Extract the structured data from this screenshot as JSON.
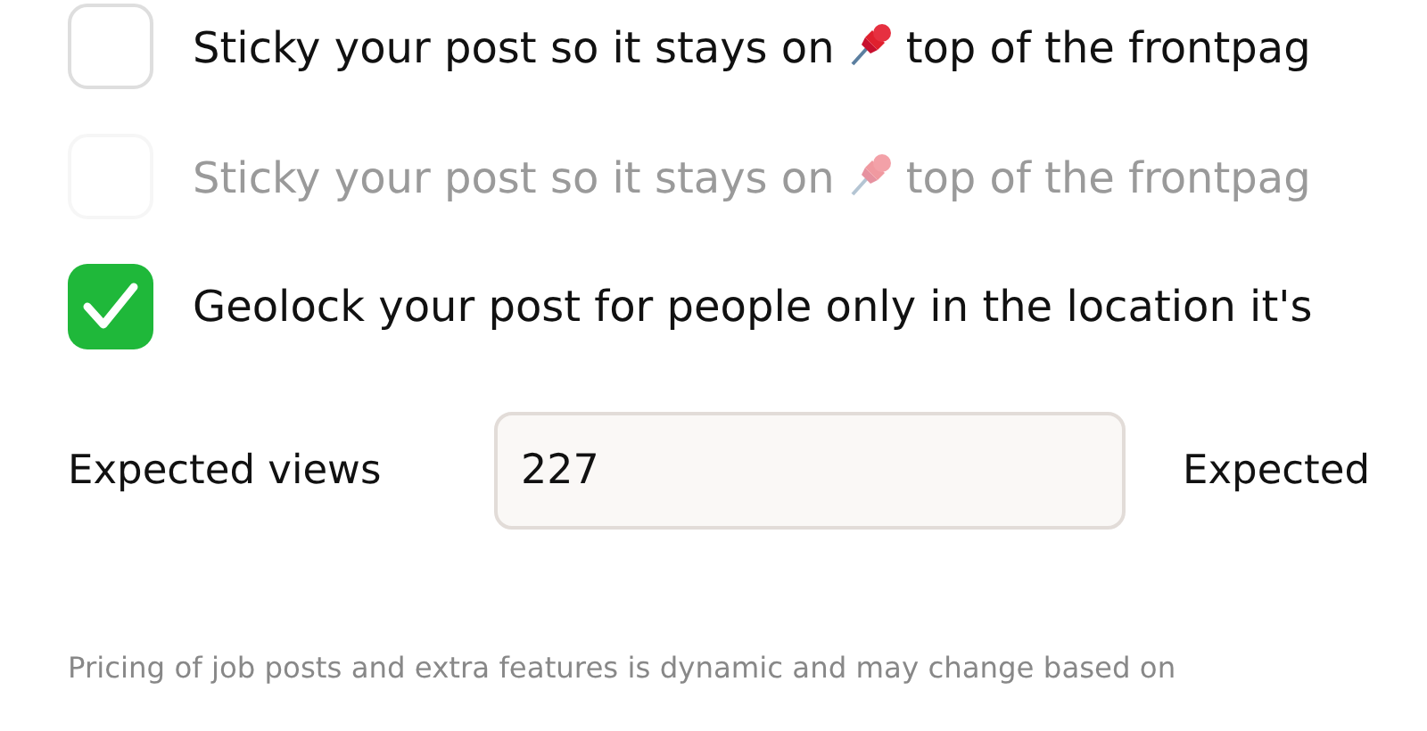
{
  "options": [
    {
      "text_before": "Sticky your post so it stays on",
      "text_after": "top of the frontpag",
      "checked": false,
      "disabled": false,
      "kind": "pin"
    },
    {
      "text_before": "Sticky your post so it stays on",
      "text_after": "top of the frontpag",
      "checked": false,
      "disabled": true,
      "kind": "pin"
    },
    {
      "text_before": "Geolock your post for people only in the location it's",
      "checked": true,
      "disabled": false,
      "kind": "plain"
    }
  ],
  "views": {
    "label": "Expected views",
    "value": "227"
  },
  "next_label": "Expected",
  "note": "Pricing of job posts and extra features is dynamic and may change based on"
}
